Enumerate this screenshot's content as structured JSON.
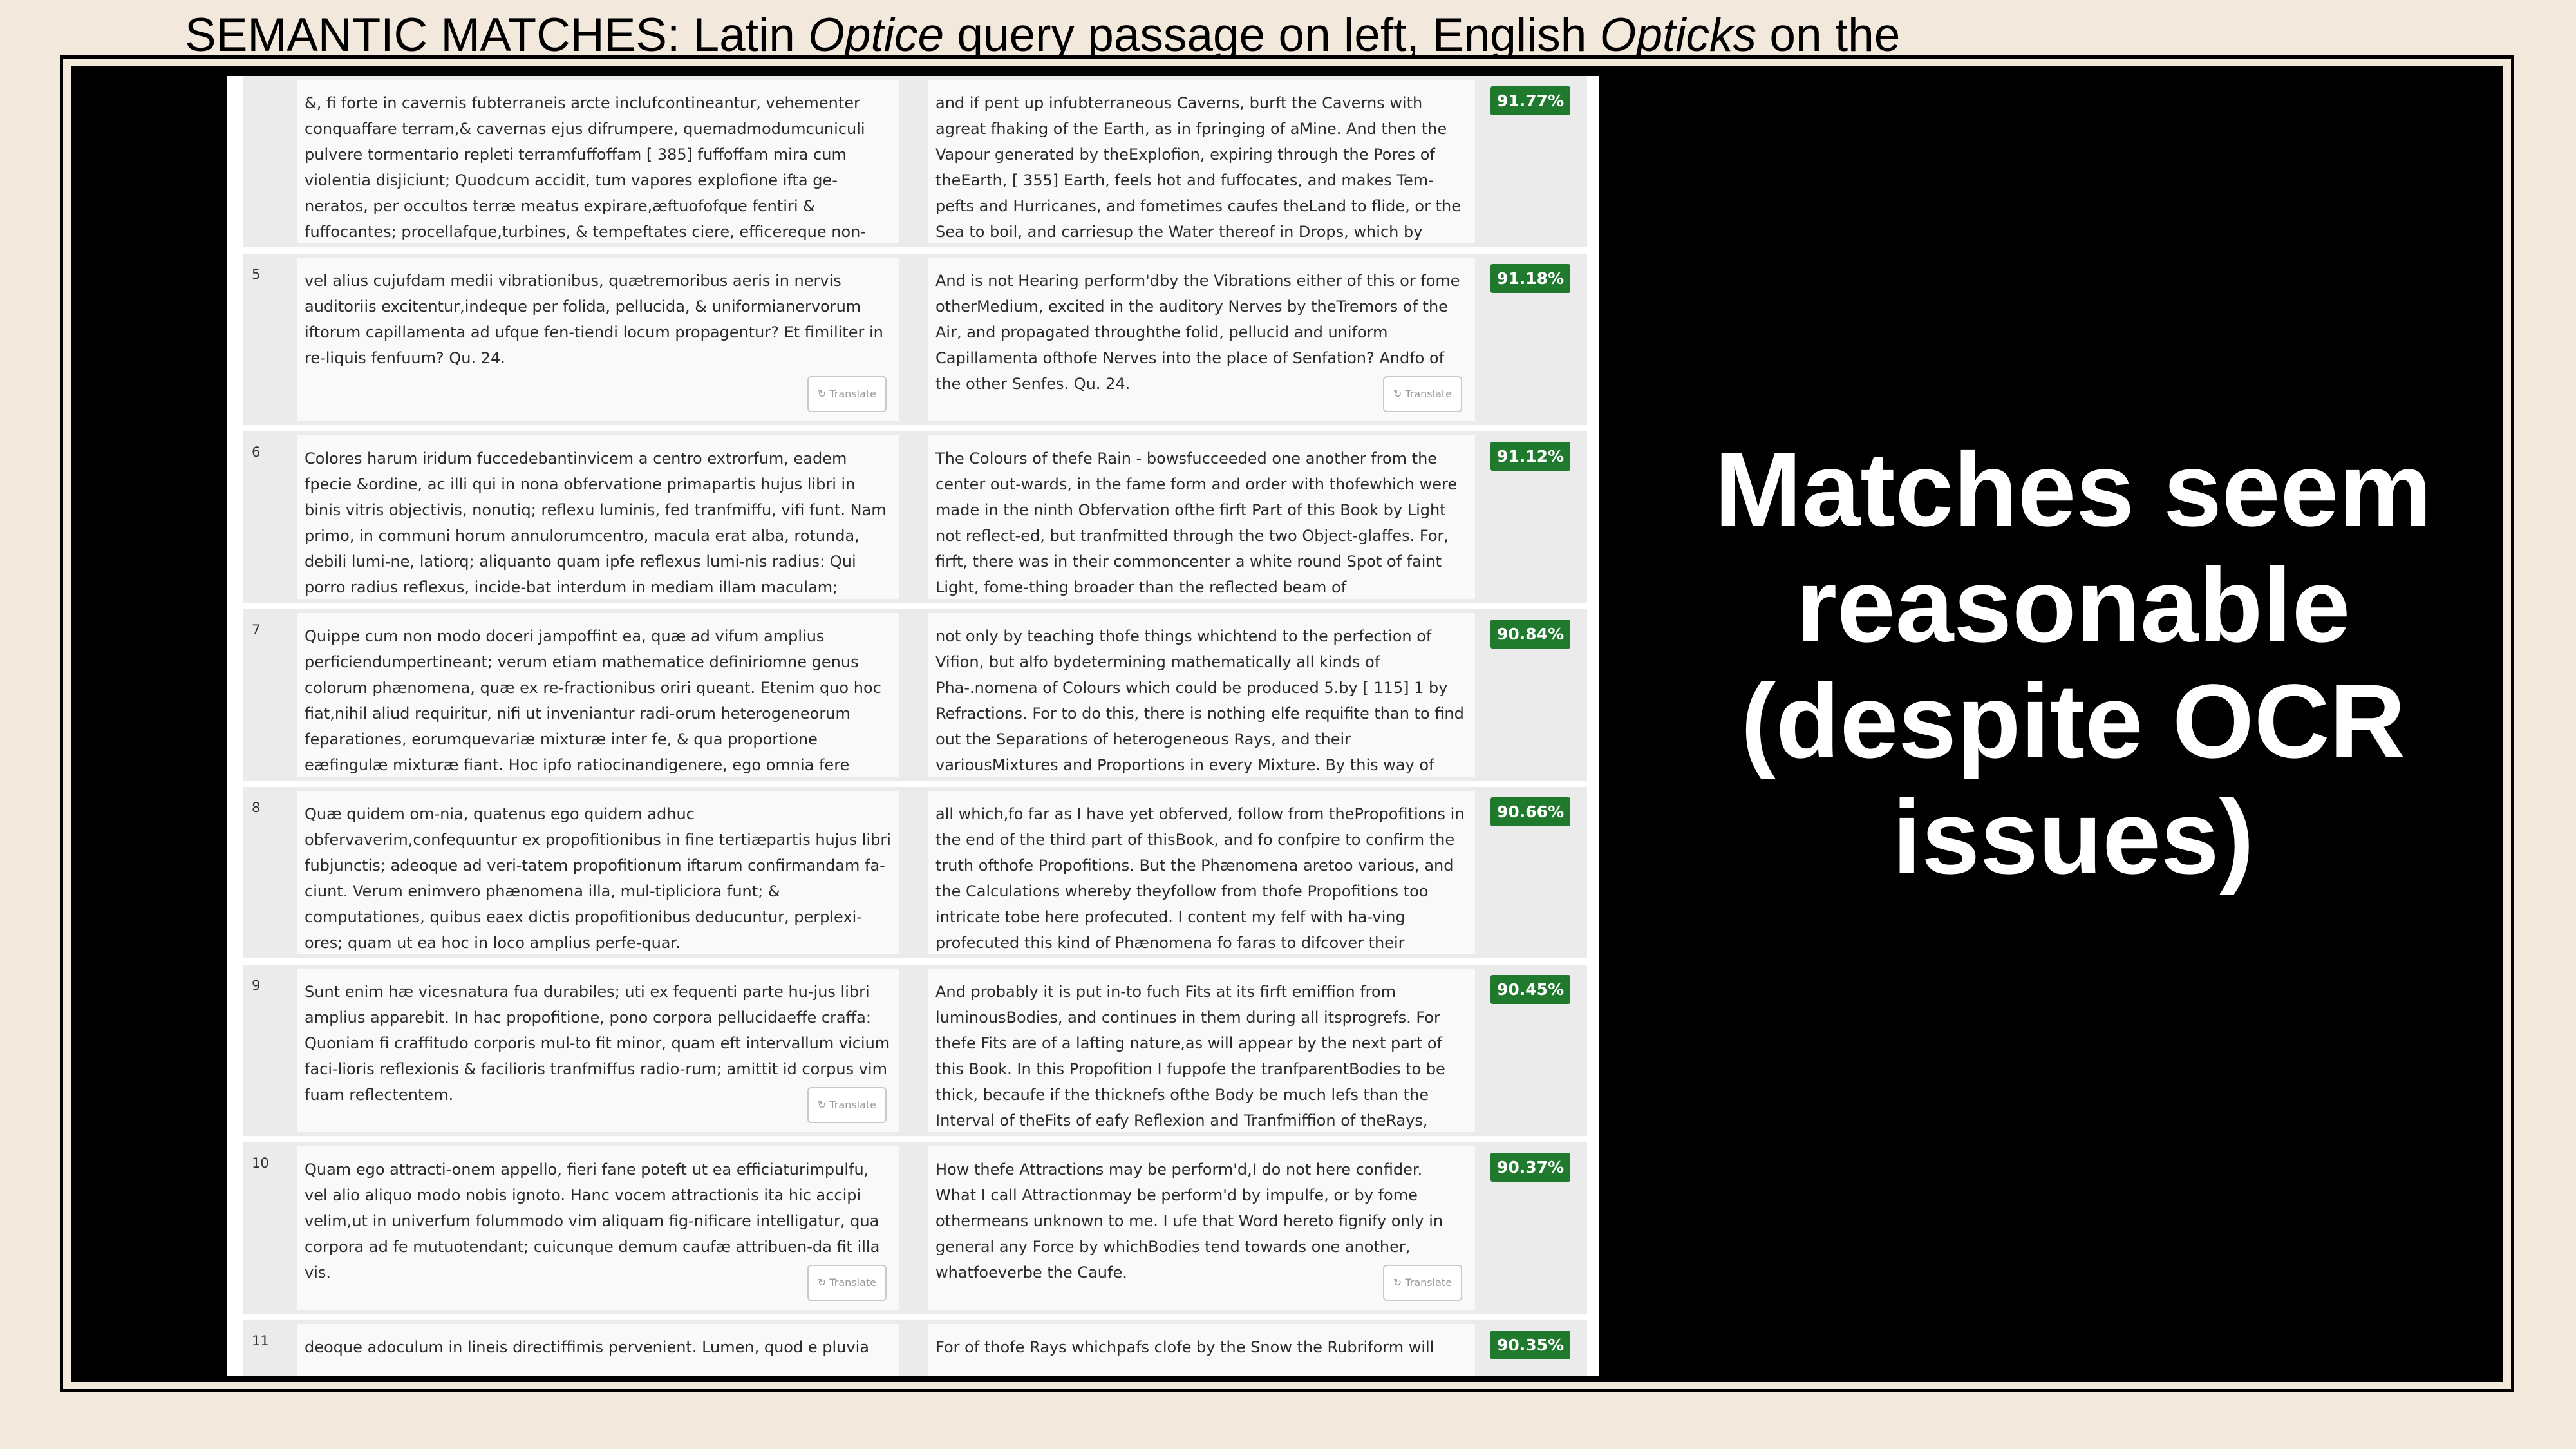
{
  "slide": {
    "title_prefix": "SEMANTIC MATCHES: Latin ",
    "title_latin": "Optice",
    "title_mid": " query passage on left, English ",
    "title_english": "Opticks",
    "title_suffix": " on the right",
    "caption": "Matches seem reasonable (despite OCR issues)"
  },
  "translate_label": "Translate",
  "rows": [
    {
      "num": "",
      "latin": "&, fi forte in cavernis fubterraneis arcte inclufcontineantur, vehementer conquaffare terram,& cavernas ejus difrumpere, quemadmodumcuniculi pulvere tormentario repleti terramfuffoffam [ 385] fuffoffam mira cum violentia disjiciunt; Quodcum accidit, tum vapores explofione ifta ge-neratos, per occultos terræ meatus expirare,æftuofofque fentiri & fuffocantes; procellafque,turbines, & tempeftates ciere, efficereque non-nunquam ut",
      "english": "and if pent up infubterraneous Caverns, burft the Caverns with agreat fhaking of the Earth, as in fpringing of aMine. And then the Vapour generated by theExplofion, expiring through the Pores of theEarth, [ 355] Earth, feels hot and fuffocates, and makes Tem-pefts and Hurricanes, and fometimes caufes theLand to flide, or the Sea to boil, and carriesup the Water thereof in Drops, which by",
      "score": "91.77%"
    },
    {
      "num": "5",
      "latin": "vel alius cujufdam medii vibrationibus, quætremoribus aeris in nervis auditoriis excitentur,indeque per folida, pellucida, & uniformianervorum iftorum capillamenta ad ufque fen-tiendi locum propagentur? Et fimiliter in re-liquis fenfuum? Qu. 24.",
      "english": "And is not Hearing perform'dby the Vibrations either of this or fome otherMedium, excited in the auditory Nerves by theTremors of the Air, and propagated throughthe folid, pellucid and uniform Capillamenta ofthofe Nerves into the place of Senfation? Andfo of the other Senfes. Qu. 24.",
      "score": "91.18%"
    },
    {
      "num": "6",
      "latin": "Colores harum iridum fuccedebantinvicem a centro extrorfum, eadem fpecie &ordine, ac illi qui in nona obfervatione primapartis hujus libri in binis vitris objectivis, nonutiq; reflexu luminis, fed tranfmiffu, vifi funt. Nam primo, in communi horum annulorumcentro, macula erat alba, rotunda, debili lumi-ne, latiorq; aliquanto quam ipfe reflexus lumi-nis radius: Qui porro radius reflexus, incide-bat interdum in mediam illam maculam;",
      "english": "The Colours of thefe Rain - bowsfucceeded one another from the center out-wards, in the fame form and order with thofewhich were made in the ninth Obfervation ofthe firft Part of this Book by Light not reflect-ed, but tranfmitted through the two Object-glaffes. For, firft, there was in their commoncenter a white round Spot of faint Light, fome-thing broader than the reflected beam of",
      "score": "91.12%"
    },
    {
      "num": "7",
      "latin": "Quippe cum non modo doceri jampoffint ea, quæ ad vifum amplius perficiendumpertineant; verum etiam mathematice definiriomne genus colorum phænomena, quæ ex re-fractionibus oriri queant. Etenim quo hoc fiat,nihil aliud requiritur, nifi ut inveniantur radi-orum heterogeneorum feparationes, eorumquevariæ mixturæ inter fe, & qua proportione eæfingulæ mixturæ fiant. Hoc ipfo ratiocinandigenere, ego omnia fere phænomena quæ",
      "english": "not only by teaching thofe things whichtend to the perfection of Vifion, but alfo bydetermining mathematically all kinds of Pha-.nomena of Colours which could be produced 5.by [ 115] 1 by Refractions. For to do this, there is nothing elfe requifite than to find out the Separations of heterogeneous Rays, and their variousMixtures and Proportions in every Mixture. By this way of",
      "score": "90.84%"
    },
    {
      "num": "8",
      "latin": "Quæ quidem om-nia, quatenus ego quidem adhuc obfervaverim,confequuntur ex propofitionibus in fine tertiæpartis hujus libri fubjunctis; adeoque ad veri-tatem propofitionum iftarum confirmandam fa-ciunt. Verum enimvero phænomena illa, mul-tipliciora funt; & computationes, quibus eaex dictis propofitionibus deducuntur, perplexi-ores; quam ut ea hoc in loco amplius perfe-quar.",
      "english": "all which,fo far as I have yet obferved, follow from thePropofitions in the end of the third part of thisBook, and fo confpire to confirm the truth ofthofe Propofitions. But the Phænomena aretoo various, and the Calculations whereby theyfollow from thofe Propofitions too intricate tobe here profecuted. I content my felf with ha-ving profecuted this kind of Phænomena fo faras to difcover their",
      "score": "90.66%"
    },
    {
      "num": "9",
      "latin": "Sunt enim hæ vicesnatura fua durabiles; uti ex fequenti parte hu-jus libri amplius apparebit. In hac propofitione, pono corpora pellucidaeffe craffa: Quoniam fi craffitudo corporis mul-to fit minor, quam eft intervallum vicium faci-lioris reflexionis & facilioris tranfmiffus radio-rum; amittit id corpus vim fuam reflectentem.",
      "english": "And probably it is put in-to fuch Fits at its firft emiffion from luminousBodies, and continues in them during all itsprogrefs. For thefe Fits are of a lafting nature,as will appear by the next part of this Book. In this Propofition I fuppofe the tranfparentBodies to be thick, becaufe if the thicknefs ofthe Body be much lefs than the Interval of theFits of eafy Reflexion and Tranfmiffion of theRays,",
      "score": "90.45%"
    },
    {
      "num": "10",
      "latin": "Quam ego attracti-onem appello, fieri fane poteft ut ea efficiaturimpulfu, vel alio aliquo modo nobis ignoto. Hanc vocem attractionis ita hic accipi velim,ut in univerfum folummodo vim aliquam fig-nificare intelligatur, qua corpora ad fe mutuotendant; cuicunque demum caufæ attribuen-da fit illa vis.",
      "english": "How thefe Attractions may be perform'd,I do not here confider. What I call Attractionmay be perform'd by impulfe, or by fome othermeans unknown to me. I ufe that Word hereto fignify only in general any Force by whichBodies tend towards one another, whatfoeverbe the Caufe.",
      "score": "90.37%"
    },
    {
      "num": "11",
      "latin": "deoque adoculum in lineis directiffimis pervenient. Lumen, quod e pluvia",
      "english": "For of thofe Rays whichpafs clofe by the Snow the Rubriform will",
      "score": "90.35%"
    }
  ]
}
